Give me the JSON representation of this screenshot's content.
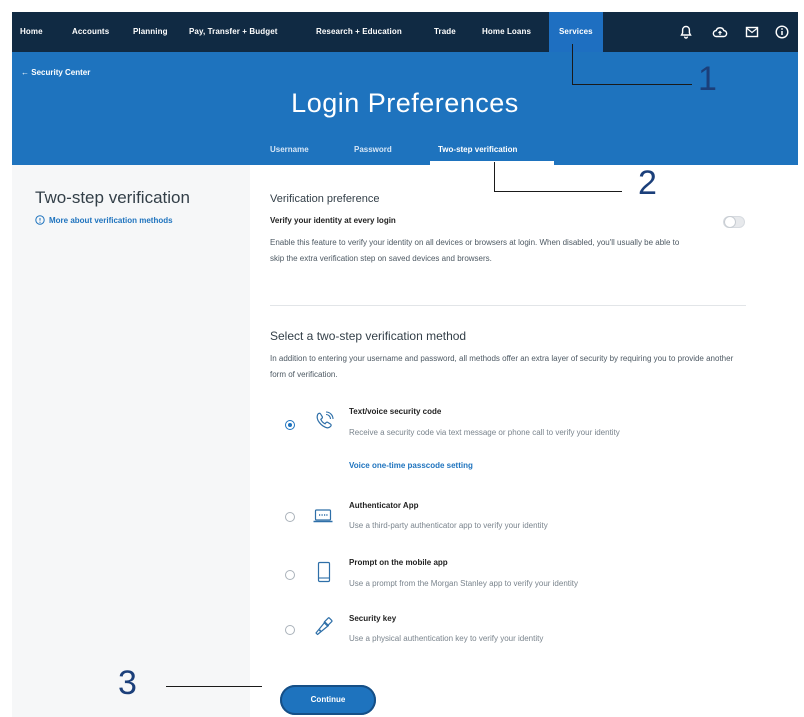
{
  "topnav": {
    "items": [
      {
        "label": "Home"
      },
      {
        "label": "Accounts"
      },
      {
        "label": "Planning"
      },
      {
        "label": "Pay, Transfer + Budget"
      },
      {
        "label": "Research + Education"
      },
      {
        "label": "Trade"
      },
      {
        "label": "Home Loans"
      },
      {
        "label": "Services",
        "active": true
      }
    ],
    "icons": [
      "bell-icon",
      "cloud-upload-icon",
      "mail-icon",
      "info-icon"
    ]
  },
  "header": {
    "back_label": "Security Center",
    "title": "Login Preferences",
    "tabs": [
      {
        "label": "Username"
      },
      {
        "label": "Password"
      },
      {
        "label": "Two-step verification",
        "active": true
      }
    ]
  },
  "left": {
    "heading": "Two-step verification",
    "more_link": "More about verification methods"
  },
  "preference": {
    "heading": "Verification preference",
    "label": "Verify your identity at every login",
    "description": "Enable this feature to verify your identity on all devices or browsers at login. When disabled, you'll usually be able to skip the extra verification step on saved devices and browsers.",
    "toggle_on": false
  },
  "methods": {
    "heading": "Select a two-step verification method",
    "description": "In addition to entering your username and password, all methods offer an extra layer of security by requiring you to provide another form of verification.",
    "options": [
      {
        "title": "Text/voice security code",
        "description": "Receive a security code via text message or phone call to verify your identity",
        "icon": "phone-icon",
        "selected": true,
        "link": "Voice one-time passcode setting"
      },
      {
        "title": "Authenticator App",
        "description": "Use a third-party authenticator app to verify your identity",
        "icon": "laptop-icon",
        "selected": false
      },
      {
        "title": "Prompt on the mobile app",
        "description": "Use a prompt from the Morgan Stanley app to verify your identity",
        "icon": "mobile-icon",
        "selected": false
      },
      {
        "title": "Security key",
        "description": "Use a physical authentication key to verify your identity",
        "icon": "security-key-icon",
        "selected": false
      }
    ]
  },
  "continue_label": "Continue",
  "callouts": [
    "1",
    "2",
    "3"
  ],
  "colors": {
    "nav": "#102a43",
    "brand_blue": "#1e73be",
    "callout": "#1b3f7a"
  }
}
